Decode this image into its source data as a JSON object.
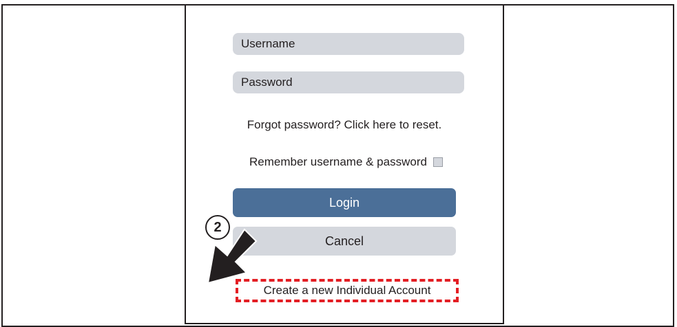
{
  "login_form": {
    "username_placeholder": "Username",
    "password_placeholder": "Password",
    "forgot_password_text": "Forgot password? Click here to reset.",
    "remember_label": "Remember username & password",
    "remember_checked": false,
    "login_label": "Login",
    "cancel_label": "Cancel",
    "create_account_label": "Create a new Individual Account"
  },
  "annotation": {
    "step_number": "2",
    "arrow_icon": "arrow-down-right-icon",
    "highlight_color": "#e31e24"
  },
  "colors": {
    "login_button": "#4b6f98",
    "field_background": "#d4d7dd"
  }
}
